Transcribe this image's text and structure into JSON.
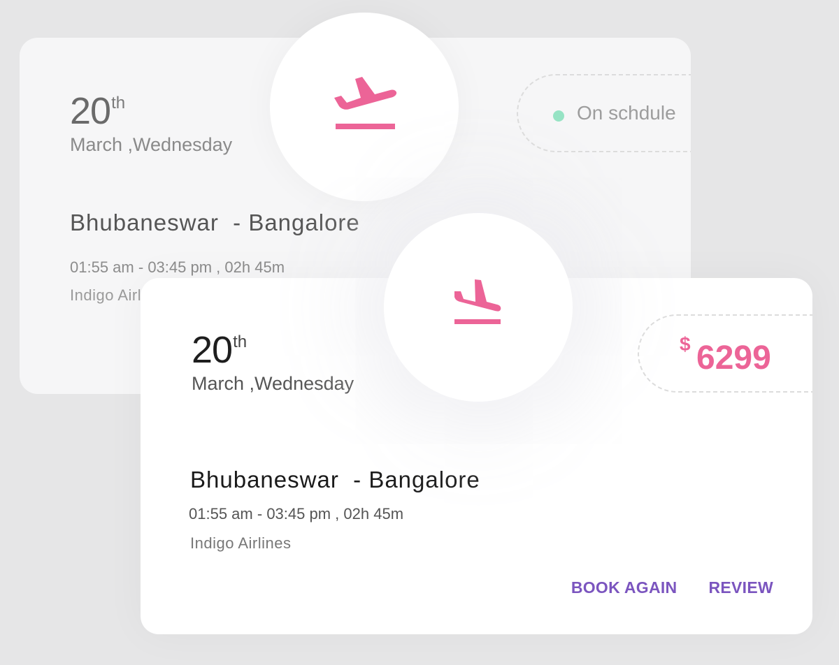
{
  "colors": {
    "page_background": "#e6e6e7",
    "back_card_background": "#f6f6f7",
    "front_card_background": "#ffffff",
    "accent_pink": "#ec6497",
    "status_green": "#96e3c4",
    "action_purple": "#7b55bf"
  },
  "back_card": {
    "date": {
      "day": "20",
      "suffix": "th",
      "month": "March",
      "separator": ",",
      "weekday": "Wednesday"
    },
    "icon": "flight-takeoff-icon",
    "status": {
      "text": "On schdule",
      "dot_icon": "status-dot"
    },
    "route": {
      "from": "Bhubaneswar",
      "to": "- Bangalore"
    },
    "times": {
      "depart": "01:55 am",
      "dash": "-",
      "arrive": "03:45 pm",
      "comma": ",",
      "duration_h": "02h",
      "duration_m": "45m"
    },
    "airline": "Indigo Airlines"
  },
  "front_card": {
    "date": {
      "day": "20",
      "suffix": "th",
      "month": "March",
      "separator": ",",
      "weekday": "Wednesday"
    },
    "icon": "flight-land-icon",
    "price": {
      "currency": "$",
      "value": "6299"
    },
    "route": {
      "from": "Bhubaneswar",
      "to": "- Bangalore"
    },
    "times": {
      "depart": "01:55 am",
      "dash": "-",
      "arrive": "03:45 pm",
      "comma": ",",
      "duration_h": "02h",
      "duration_m": "45m"
    },
    "airline": "Indigo Airlines",
    "actions": {
      "book_again": "BOOK AGAIN",
      "review": "REVIEW"
    }
  }
}
